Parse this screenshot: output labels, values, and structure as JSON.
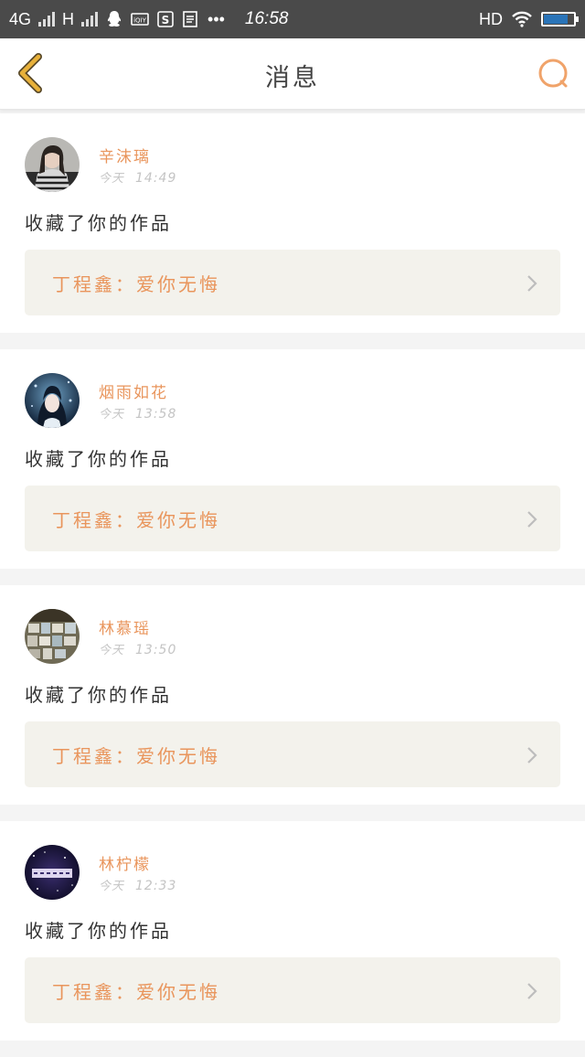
{
  "status_bar": {
    "network_1": "4G",
    "network_2": "H",
    "time": "16:58",
    "hd": "HD",
    "more": "•••",
    "battery_level": 0.75
  },
  "header": {
    "title": "消息",
    "back_icon": "chevron-left-icon",
    "search_icon": "search-icon"
  },
  "messages": [
    {
      "name": "辛沫璃",
      "day": "今天",
      "time": "14:49",
      "action": "收藏了你的作品",
      "work": "丁程鑫：爱你无悔"
    },
    {
      "name": "烟雨如花",
      "day": "今天",
      "time": "13:58",
      "action": "收藏了你的作品",
      "work": "丁程鑫：爱你无悔"
    },
    {
      "name": "林慕瑶",
      "day": "今天",
      "time": "13:50",
      "action": "收藏了你的作品",
      "work": "丁程鑫：爱你无悔"
    },
    {
      "name": "林柠檬",
      "day": "今天",
      "time": "12:33",
      "action": "收藏了你的作品",
      "work": "丁程鑫：爱你无悔"
    }
  ],
  "colors": {
    "accent": "#e9955c",
    "back_icon": "#e8b13a",
    "status_bar": "#4a4a4a",
    "work_bg": "#f3f2ec"
  }
}
